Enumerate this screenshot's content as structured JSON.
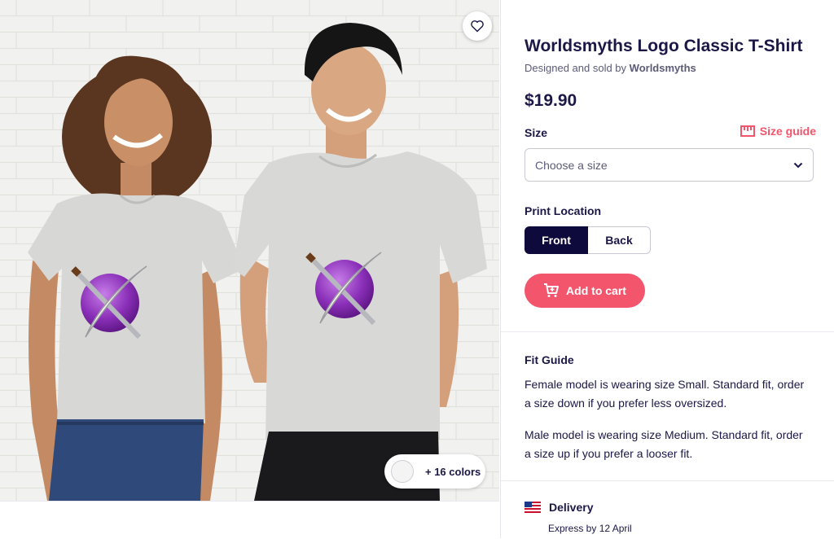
{
  "product": {
    "title": "Worldsmyths Logo Classic T-Shirt",
    "byline_prefix": "Designed and sold by",
    "seller": "Worldsmyths",
    "price": "$19.90"
  },
  "image": {
    "more_colors_label": "+ 16 colors"
  },
  "size": {
    "label": "Size",
    "guide_label": "Size guide",
    "placeholder": "Choose a size"
  },
  "print_location": {
    "label": "Print Location",
    "options": [
      "Front",
      "Back"
    ],
    "selected": "Front"
  },
  "cart": {
    "button_label": "Add to cart"
  },
  "fit_guide": {
    "title": "Fit Guide",
    "paragraphs": [
      "Female model is wearing size Small. Standard fit, order a size down if you prefer less oversized.",
      "Male model is wearing size Medium. Standard fit, order a size up if you prefer a looser fit."
    ]
  },
  "delivery": {
    "title": "Delivery",
    "subtitle": "Express by 12 April"
  },
  "colors": {
    "accent": "#f2556c",
    "primary_dark": "#0f0a3c",
    "text": "#1b1747",
    "muted": "#5c5a77"
  },
  "icons": [
    "heart-icon",
    "ruler-icon",
    "chevron-down-icon",
    "cart-plus-icon",
    "us-flag-icon"
  ]
}
